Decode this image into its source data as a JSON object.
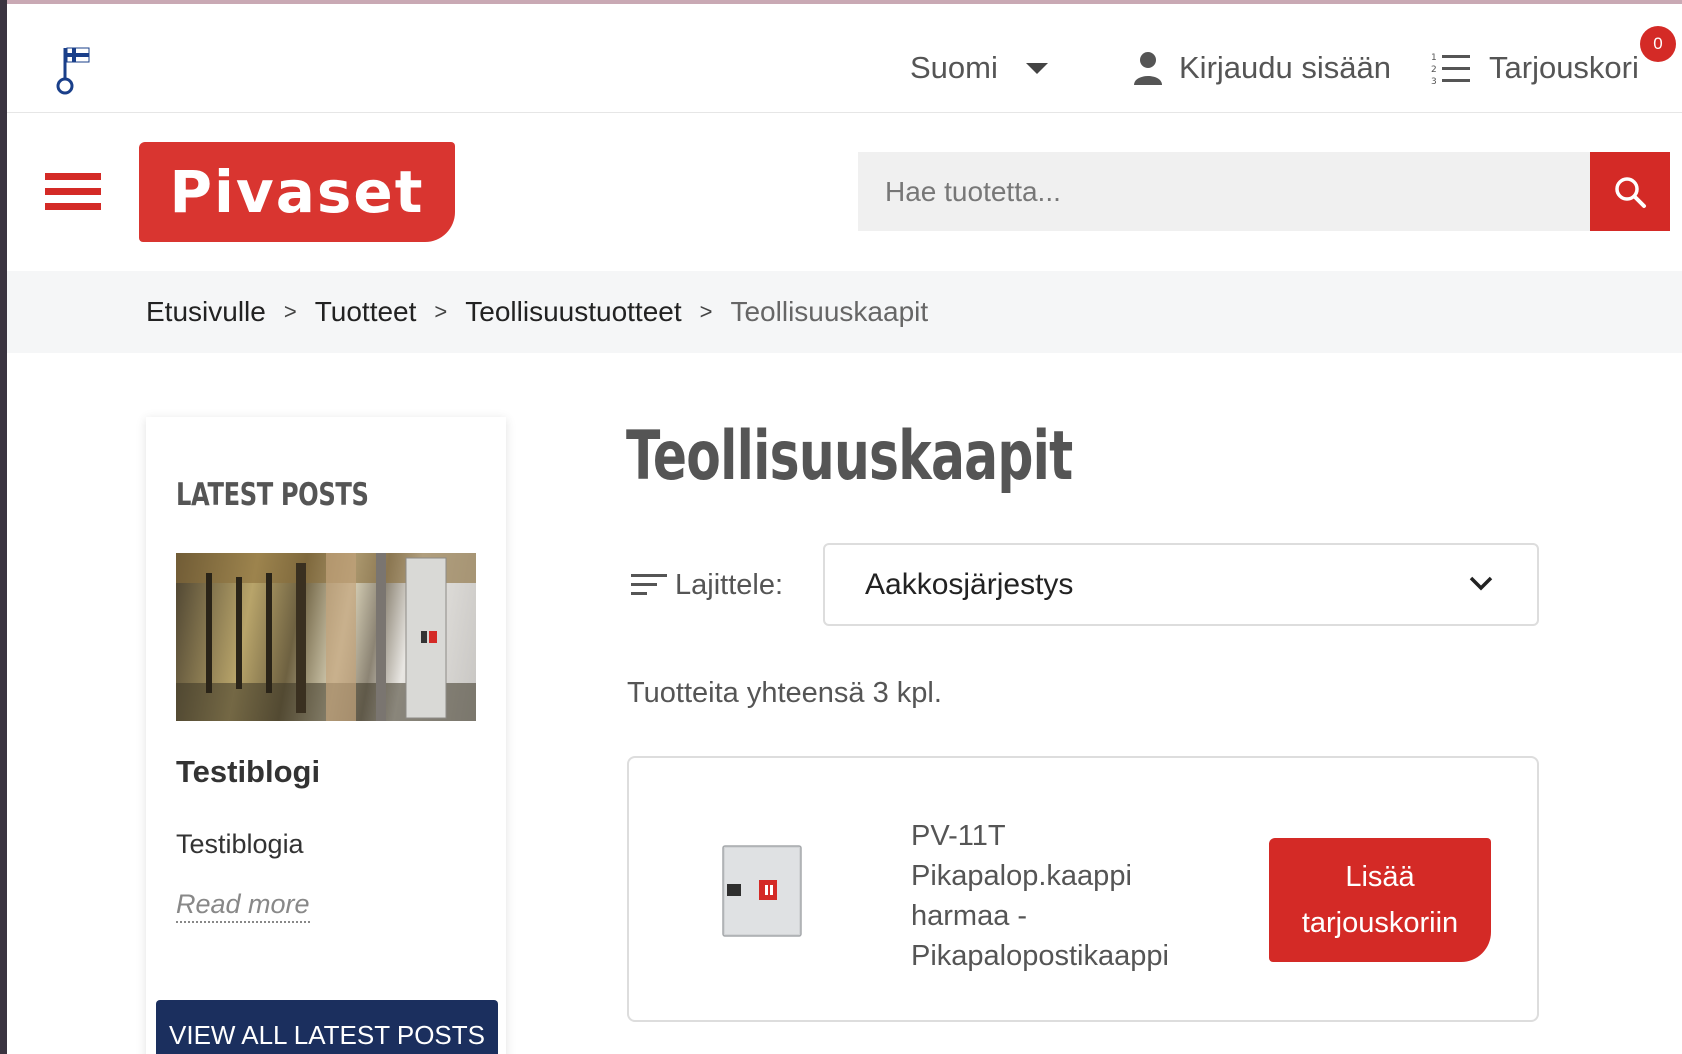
{
  "topbar": {
    "language": "Suomi",
    "login": "Kirjaudu sisään",
    "cart_label": "Tarjouskori",
    "cart_count": "0"
  },
  "header": {
    "logo_text": "Pivaset",
    "search_placeholder": "Hae tuotetta..."
  },
  "breadcrumb": [
    {
      "label": "Etusivulle"
    },
    {
      "label": "Tuotteet"
    },
    {
      "label": "Teollisuustuotteet"
    },
    {
      "label": "Teollisuuskaapit"
    }
  ],
  "breadcrumb_separator": ">",
  "sidebar": {
    "title": "LATEST POSTS",
    "post_title": "Testiblogi",
    "post_excerpt": "Testiblogia",
    "read_more": "Read more",
    "view_all": "VIEW ALL LATEST POSTS"
  },
  "main": {
    "title": "Teollisuuskaapit",
    "sort_label": "Lajittele:",
    "sort_value": "Aakkosjärjestys",
    "total_text": "Tuotteita yhteensä 3 kpl.",
    "products": [
      {
        "name_line1": "PV-11T",
        "name_line2": "Pikapalop.kaappi",
        "name_line3": "harmaa -",
        "name_line4": "Pikapalopostikaappi",
        "button_line1": "Lisää",
        "button_line2": "tarjouskoriin"
      }
    ]
  },
  "colors": {
    "brand_red": "#d42a26",
    "navy": "#1b2f5e"
  }
}
